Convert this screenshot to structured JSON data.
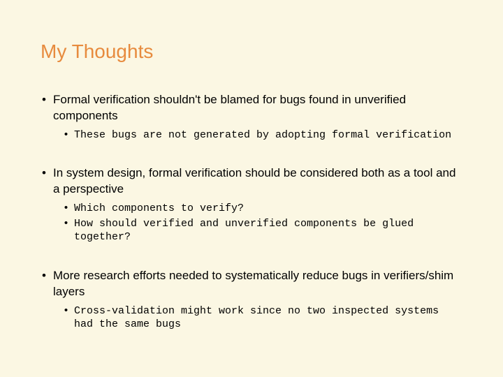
{
  "title": "My Thoughts",
  "bullets": [
    {
      "text": "Formal verification shouldn't be blamed for bugs found in unverified components",
      "sub": [
        "These bugs are not generated by adopting formal verification"
      ]
    },
    {
      "text": "In system design, formal verification should be considered both as a tool and a perspective",
      "sub": [
        "Which components to verify?",
        "How should verified and unverified components be glued together?"
      ]
    },
    {
      "text": "More research efforts needed to systematically reduce bugs in verifiers/shim layers",
      "sub": [
        "Cross-validation might work since no two inspected systems had the same bugs"
      ]
    }
  ]
}
